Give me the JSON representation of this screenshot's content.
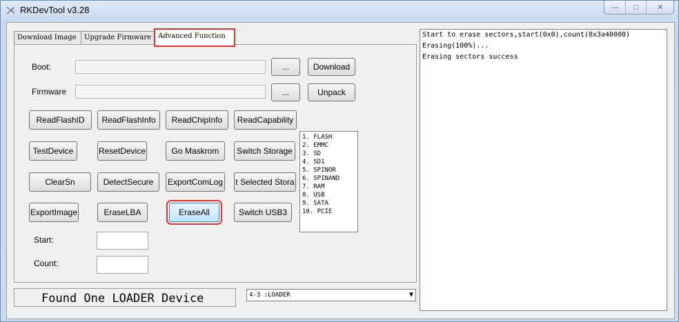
{
  "window": {
    "title": "RKDevTool v3.28"
  },
  "tabs": [
    {
      "label": "Download Image"
    },
    {
      "label": "Upgrade Firmware"
    },
    {
      "label": "Advanced Function"
    }
  ],
  "form": {
    "boot_label": "Boot:",
    "firmware_label": "Firmware",
    "browse_label": "...",
    "download_label": "Download",
    "unpack_label": "Unpack",
    "start_label": "Start:",
    "count_label": "Count:"
  },
  "buttons": {
    "read_flash_id": "ReadFlashID",
    "read_flash_info": "ReadFlashInfo",
    "read_chip_info": "ReadChipInfo",
    "read_capability": "ReadCapability",
    "test_device": "TestDevice",
    "reset_device": "ResetDevice",
    "go_maskrom": "Go Maskrom",
    "switch_storage": "Switch Storage",
    "clear_sn": "ClearSn",
    "detect_secure": "DetectSecure",
    "export_com_log": "ExportComLog",
    "selected_storage": "t Selected Stora",
    "export_image": "ExportImage",
    "erase_lba": "EraseLBA",
    "erase_all": "EraseAll",
    "switch_usb3": "Switch USB3"
  },
  "storage_list": [
    "1. FLASH",
    "2. EMMC",
    "3. SD",
    "4. SD1",
    "5. SPINOR",
    "6. SPINAND",
    "7. RAM",
    "8. USB",
    "9. SATA",
    "10. PCIE"
  ],
  "status": {
    "text": "Found One LOADER Device"
  },
  "device_select": {
    "value": "4-3 :LOADER"
  },
  "log": {
    "lines": [
      "Start to erase sectors,start(0x0),count(0x3a40000)",
      "Erasing(100%)...",
      "Erasing sectors success"
    ]
  },
  "colors": {
    "highlight": "#dd3333",
    "title_bg": "#cfe0f2"
  }
}
